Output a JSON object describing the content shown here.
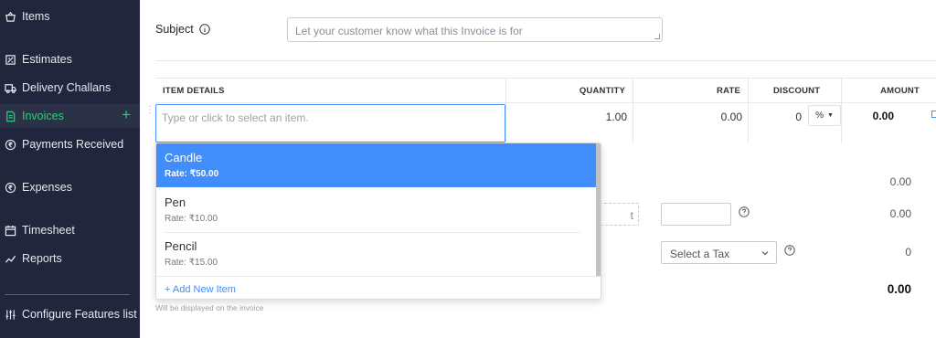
{
  "sidebar": {
    "items": [
      {
        "label": "Items",
        "icon": "basket-icon"
      },
      {
        "label": "Estimates",
        "icon": "estimate-icon"
      },
      {
        "label": "Delivery Challans",
        "icon": "truck-icon"
      },
      {
        "label": "Invoices",
        "icon": "invoice-icon",
        "active": true
      },
      {
        "label": "Payments Received",
        "icon": "rupee-coin-icon"
      },
      {
        "label": "Expenses",
        "icon": "rupee-coin-icon"
      },
      {
        "label": "Timesheet",
        "icon": "calendar-icon"
      },
      {
        "label": "Reports",
        "icon": "chart-icon"
      }
    ],
    "add_icon": "+",
    "configure_label": "Configure Features list"
  },
  "form": {
    "subject_label": "Subject",
    "subject_placeholder": "Let your customer know what this Invoice is for"
  },
  "table": {
    "headers": {
      "item_details": "ITEM DETAILS",
      "quantity": "QUANTITY",
      "rate": "RATE",
      "discount": "DISCOUNT",
      "amount": "AMOUNT"
    },
    "row": {
      "item_placeholder": "Type or click to select an item.",
      "quantity": "1.00",
      "rate": "0.00",
      "discount": "0",
      "discount_unit": "%",
      "amount": "0.00"
    }
  },
  "dropdown": {
    "items": [
      {
        "name": "Candle",
        "rate": "Rate: ₹50.00"
      },
      {
        "name": "Pen",
        "rate": "Rate: ₹10.00"
      },
      {
        "name": "Pencil",
        "rate": "Rate: ₹15.00"
      }
    ],
    "add_new_label": "+ Add New Item"
  },
  "summary": {
    "subtotal": "0.00",
    "dashed_partial": "t",
    "adjustment": "0.00",
    "tax_placeholder": "Select a Tax",
    "tax_value": "0",
    "total": "0.00",
    "note": "Will be displayed on the invoice"
  },
  "colors": {
    "sidebar_bg": "#21263c",
    "active_green": "#2ecb7b",
    "accent_blue": "#408dfb"
  }
}
